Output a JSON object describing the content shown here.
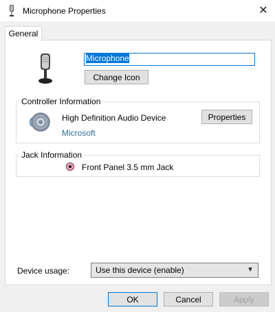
{
  "window": {
    "title": "Microphone Properties",
    "close_glyph": "✕"
  },
  "tabs": [
    {
      "label": "General"
    }
  ],
  "device": {
    "name": "Microphone",
    "change_icon_label": "Change Icon"
  },
  "controller": {
    "group_label": "Controller Information",
    "device_name": "High Definition Audio Device",
    "vendor": "Microsoft",
    "properties_label": "Properties"
  },
  "jack": {
    "group_label": "Jack Information",
    "text": "Front Panel 3.5 mm Jack",
    "color": "#e6a9c0"
  },
  "usage": {
    "label": "Device usage:",
    "selected": "Use this device (enable)"
  },
  "buttons": {
    "ok": "OK",
    "cancel": "Cancel",
    "apply": "Apply"
  },
  "colors": {
    "accent": "#0078d7",
    "link": "#2f6b96"
  }
}
